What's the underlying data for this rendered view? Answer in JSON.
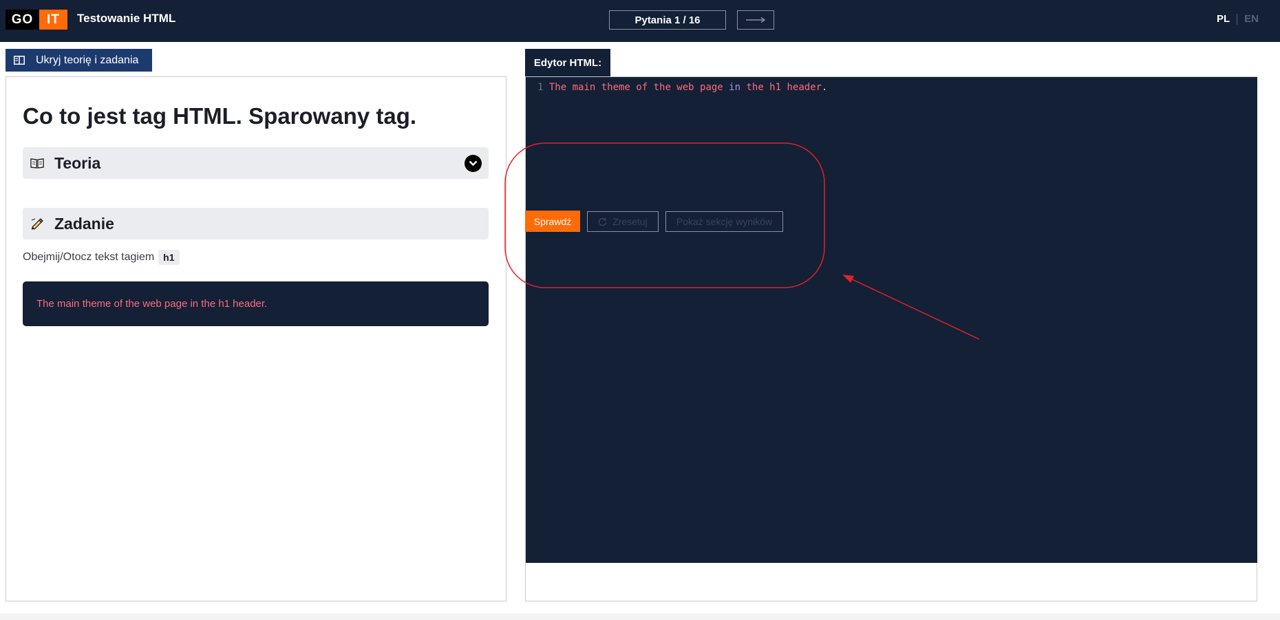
{
  "header": {
    "logo_go": "GO",
    "logo_it": "IT",
    "title": "Testowanie HTML",
    "counter": "Pytania 1 / 16",
    "next_icon": "arrow-right-icon",
    "lang_pl": "PL",
    "lang_en": "EN"
  },
  "left": {
    "hide_button": "Ukryj teorię i zadania",
    "lesson_title": "Co to jest tag HTML. Sparowany tag.",
    "theory_label": "Teoria",
    "task_label": "Zadanie",
    "task_text": "Obejmij/Otocz tekst tagiem",
    "task_tag": "h1",
    "sample_text": "The main theme of the web page in the h1 header."
  },
  "editor": {
    "tab_label": "Edytor HTML:",
    "line_number": "1",
    "code_part1": "The main theme of the web page ",
    "code_kw": "in",
    "code_part2": " the h1 header",
    "code_dot": "."
  },
  "actions": {
    "check": "Sprawdź",
    "reset": "Zresetuj",
    "show_result": "Pokaż sekcję wyników"
  },
  "colors": {
    "navy": "#132035",
    "accent_orange": "#ff6b08",
    "annotation_red": "#e3202a"
  }
}
